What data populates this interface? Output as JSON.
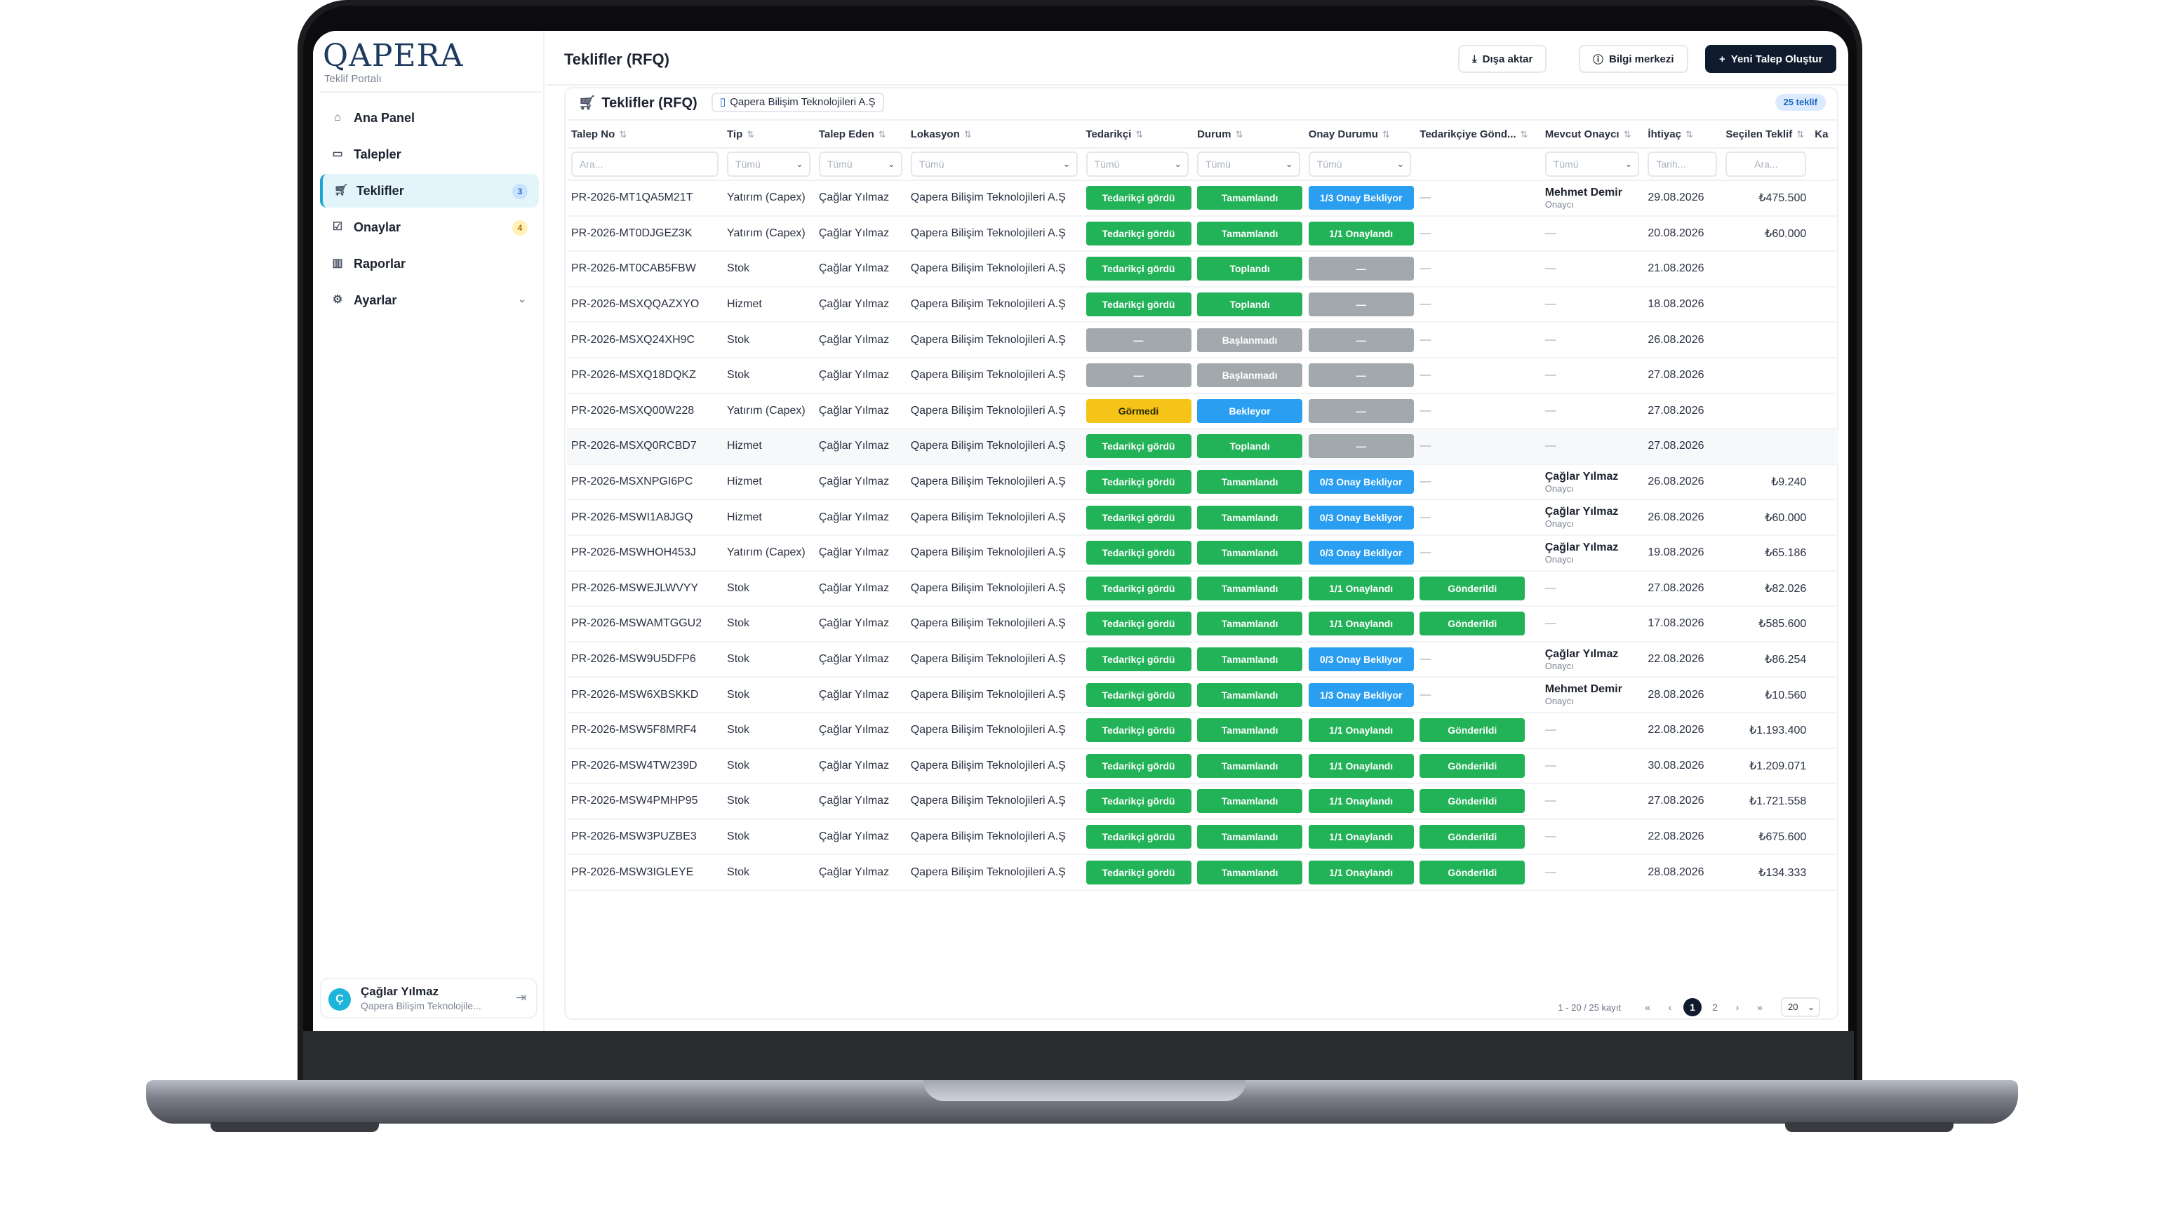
{
  "app": {
    "logo": "QAPERA",
    "subtitle": "Teklif Portalı"
  },
  "sidebar": {
    "items": [
      {
        "label": "Ana Panel",
        "icon": "home-icon"
      },
      {
        "label": "Talepler",
        "icon": "document-icon"
      },
      {
        "label": "Teklifler",
        "icon": "cart-icon",
        "badge": "3",
        "active": true
      },
      {
        "label": "Onaylar",
        "icon": "check-square-icon",
        "badge": "4"
      },
      {
        "label": "Raporlar",
        "icon": "bar-chart-icon"
      },
      {
        "label": "Ayarlar",
        "icon": "gear-icon"
      }
    ],
    "user": {
      "initial": "Ç",
      "name": "Çağlar Yılmaz",
      "company": "Qapera Bilişim Teknolojile..."
    }
  },
  "header": {
    "title": "Teklifler (RFQ)",
    "export_label": "Dışa aktar",
    "info_label": "Bilgi merkezi",
    "new_label": "Yeni Talep Oluştur"
  },
  "card": {
    "title": "Teklifler (RFQ)",
    "company": "Qapera Bilişim Teknolojileri A.Ş",
    "count": "25 teklif"
  },
  "table": {
    "columns": [
      "Talep No",
      "Tip",
      "Talep Eden",
      "Lokasyon",
      "Tedarikçi",
      "Durum",
      "Onay Durumu",
      "Tedarikçiye Gönd...",
      "Mevcut Onaycı",
      "İhtiyaç",
      "Seçilen Teklif",
      "Ka"
    ],
    "filters": {
      "talep_no": "Ara...",
      "tip": "Tümü",
      "talep_eden": "Tümü",
      "lokasyon": "Tümü",
      "tedarikci": "Tümü",
      "durum": "Tümü",
      "onay": "Tümü",
      "onayci": "Tümü",
      "ihtiyac": "Tarih...",
      "secilen": "Ara..."
    },
    "rows": [
      {
        "no": "PR-2026-MT1QA5M21T",
        "tip": "Yatırım (Capex)",
        "eden": "Çağlar Yılmaz",
        "lok": "Qapera Bilişim Teknolojileri A.Ş",
        "ted": "Tedarikçi gördü",
        "ted_c": "green",
        "dur": "Tamamlandı",
        "dur_c": "green",
        "onay": "1/3 Onay Bekliyor",
        "onay_c": "blue",
        "gond": "—",
        "gond_c": "",
        "onayci": "Mehmet Demir",
        "rol": "Onaycı",
        "tarih": "29.08.2026",
        "teklif": "₺475.500"
      },
      {
        "no": "PR-2026-MT0DJGEZ3K",
        "tip": "Yatırım (Capex)",
        "eden": "Çağlar Yılmaz",
        "lok": "Qapera Bilişim Teknolojileri A.Ş",
        "ted": "Tedarikçi gördü",
        "ted_c": "green",
        "dur": "Tamamlandı",
        "dur_c": "green",
        "onay": "1/1 Onaylandı",
        "onay_c": "green",
        "gond": "—",
        "gond_c": "",
        "onayci": "—",
        "rol": "",
        "tarih": "20.08.2026",
        "teklif": "₺60.000"
      },
      {
        "no": "PR-2026-MT0CAB5FBW",
        "tip": "Stok",
        "eden": "Çağlar Yılmaz",
        "lok": "Qapera Bilişim Teknolojileri A.Ş",
        "ted": "Tedarikçi gördü",
        "ted_c": "green",
        "dur": "Toplandı",
        "dur_c": "green",
        "onay": "—",
        "onay_c": "gray",
        "gond": "—",
        "gond_c": "",
        "onayci": "—",
        "rol": "",
        "tarih": "21.08.2026",
        "teklif": ""
      },
      {
        "no": "PR-2026-MSXQQAZXYO",
        "tip": "Hizmet",
        "eden": "Çağlar Yılmaz",
        "lok": "Qapera Bilişim Teknolojileri A.Ş",
        "ted": "Tedarikçi gördü",
        "ted_c": "green",
        "dur": "Toplandı",
        "dur_c": "green",
        "onay": "—",
        "onay_c": "gray",
        "gond": "—",
        "gond_c": "",
        "onayci": "—",
        "rol": "",
        "tarih": "18.08.2026",
        "teklif": ""
      },
      {
        "no": "PR-2026-MSXQ24XH9C",
        "tip": "Stok",
        "eden": "Çağlar Yılmaz",
        "lok": "Qapera Bilişim Teknolojileri A.Ş",
        "ted": "—",
        "ted_c": "gray",
        "dur": "Başlanmadı",
        "dur_c": "gray",
        "onay": "—",
        "onay_c": "gray",
        "gond": "—",
        "gond_c": "",
        "onayci": "—",
        "rol": "",
        "tarih": "26.08.2026",
        "teklif": ""
      },
      {
        "no": "PR-2026-MSXQ18DQKZ",
        "tip": "Stok",
        "eden": "Çağlar Yılmaz",
        "lok": "Qapera Bilişim Teknolojileri A.Ş",
        "ted": "—",
        "ted_c": "gray",
        "dur": "Başlanmadı",
        "dur_c": "gray",
        "onay": "—",
        "onay_c": "gray",
        "gond": "—",
        "gond_c": "",
        "onayci": "—",
        "rol": "",
        "tarih": "27.08.2026",
        "teklif": ""
      },
      {
        "no": "PR-2026-MSXQ00W228",
        "tip": "Yatırım (Capex)",
        "eden": "Çağlar Yılmaz",
        "lok": "Qapera Bilişim Teknolojileri A.Ş",
        "ted": "Görmedi",
        "ted_c": "yellow",
        "dur": "Bekleyor",
        "dur_c": "blue",
        "onay": "—",
        "onay_c": "gray",
        "gond": "—",
        "gond_c": "",
        "onayci": "—",
        "rol": "",
        "tarih": "27.08.2026",
        "teklif": ""
      },
      {
        "no": "PR-2026-MSXQ0RCBD7",
        "tip": "Hizmet",
        "eden": "Çağlar Yılmaz",
        "lok": "Qapera Bilişim Teknolojileri A.Ş",
        "ted": "Tedarikçi gördü",
        "ted_c": "green",
        "dur": "Toplandı",
        "dur_c": "green",
        "onay": "—",
        "onay_c": "gray",
        "gond": "—",
        "gond_c": "",
        "onayci": "—",
        "rol": "",
        "tarih": "27.08.2026",
        "teklif": ""
      },
      {
        "no": "PR-2026-MSXNPGI6PC",
        "tip": "Hizmet",
        "eden": "Çağlar Yılmaz",
        "lok": "Qapera Bilişim Teknolojileri A.Ş",
        "ted": "Tedarikçi gördü",
        "ted_c": "green",
        "dur": "Tamamlandı",
        "dur_c": "green",
        "onay": "0/3 Onay Bekliyor",
        "onay_c": "blue",
        "gond": "—",
        "gond_c": "",
        "onayci": "Çağlar Yılmaz",
        "rol": "Onaycı",
        "tarih": "26.08.2026",
        "teklif": "₺9.240"
      },
      {
        "no": "PR-2026-MSWI1A8JGQ",
        "tip": "Hizmet",
        "eden": "Çağlar Yılmaz",
        "lok": "Qapera Bilişim Teknolojileri A.Ş",
        "ted": "Tedarikçi gördü",
        "ted_c": "green",
        "dur": "Tamamlandı",
        "dur_c": "green",
        "onay": "0/3 Onay Bekliyor",
        "onay_c": "blue",
        "gond": "—",
        "gond_c": "",
        "onayci": "Çağlar Yılmaz",
        "rol": "Onaycı",
        "tarih": "26.08.2026",
        "teklif": "₺60.000"
      },
      {
        "no": "PR-2026-MSWHOH453J",
        "tip": "Yatırım (Capex)",
        "eden": "Çağlar Yılmaz",
        "lok": "Qapera Bilişim Teknolojileri A.Ş",
        "ted": "Tedarikçi gördü",
        "ted_c": "green",
        "dur": "Tamamlandı",
        "dur_c": "green",
        "onay": "0/3 Onay Bekliyor",
        "onay_c": "blue",
        "gond": "—",
        "gond_c": "",
        "onayci": "Çağlar Yılmaz",
        "rol": "Onaycı",
        "tarih": "19.08.2026",
        "teklif": "₺65.186"
      },
      {
        "no": "PR-2026-MSWEJLWVYY",
        "tip": "Stok",
        "eden": "Çağlar Yılmaz",
        "lok": "Qapera Bilişim Teknolojileri A.Ş",
        "ted": "Tedarikçi gördü",
        "ted_c": "green",
        "dur": "Tamamlandı",
        "dur_c": "green",
        "onay": "1/1 Onaylandı",
        "onay_c": "green",
        "gond": "Gönderildi",
        "gond_c": "green",
        "onayci": "—",
        "rol": "",
        "tarih": "27.08.2026",
        "teklif": "₺82.026"
      },
      {
        "no": "PR-2026-MSWAMTGGU2",
        "tip": "Stok",
        "eden": "Çağlar Yılmaz",
        "lok": "Qapera Bilişim Teknolojileri A.Ş",
        "ted": "Tedarikçi gördü",
        "ted_c": "green",
        "dur": "Tamamlandı",
        "dur_c": "green",
        "onay": "1/1 Onaylandı",
        "onay_c": "green",
        "gond": "Gönderildi",
        "gond_c": "green",
        "onayci": "—",
        "rol": "",
        "tarih": "17.08.2026",
        "teklif": "₺585.600"
      },
      {
        "no": "PR-2026-MSW9U5DFP6",
        "tip": "Stok",
        "eden": "Çağlar Yılmaz",
        "lok": "Qapera Bilişim Teknolojileri A.Ş",
        "ted": "Tedarikçi gördü",
        "ted_c": "green",
        "dur": "Tamamlandı",
        "dur_c": "green",
        "onay": "0/3 Onay Bekliyor",
        "onay_c": "blue",
        "gond": "—",
        "gond_c": "",
        "onayci": "Çağlar Yılmaz",
        "rol": "Onaycı",
        "tarih": "22.08.2026",
        "teklif": "₺86.254"
      },
      {
        "no": "PR-2026-MSW6XBSKKD",
        "tip": "Stok",
        "eden": "Çağlar Yılmaz",
        "lok": "Qapera Bilişim Teknolojileri A.Ş",
        "ted": "Tedarikçi gördü",
        "ted_c": "green",
        "dur": "Tamamlandı",
        "dur_c": "green",
        "onay": "1/3 Onay Bekliyor",
        "onay_c": "blue",
        "gond": "—",
        "gond_c": "",
        "onayci": "Mehmet Demir",
        "rol": "Onaycı",
        "tarih": "28.08.2026",
        "teklif": "₺10.560"
      },
      {
        "no": "PR-2026-MSW5F8MRF4",
        "tip": "Stok",
        "eden": "Çağlar Yılmaz",
        "lok": "Qapera Bilişim Teknolojileri A.Ş",
        "ted": "Tedarikçi gördü",
        "ted_c": "green",
        "dur": "Tamamlandı",
        "dur_c": "green",
        "onay": "1/1 Onaylandı",
        "onay_c": "green",
        "gond": "Gönderildi",
        "gond_c": "green",
        "onayci": "—",
        "rol": "",
        "tarih": "22.08.2026",
        "teklif": "₺1.193.400"
      },
      {
        "no": "PR-2026-MSW4TW239D",
        "tip": "Stok",
        "eden": "Çağlar Yılmaz",
        "lok": "Qapera Bilişim Teknolojileri A.Ş",
        "ted": "Tedarikçi gördü",
        "ted_c": "green",
        "dur": "Tamamlandı",
        "dur_c": "green",
        "onay": "1/1 Onaylandı",
        "onay_c": "green",
        "gond": "Gönderildi",
        "gond_c": "green",
        "onayci": "—",
        "rol": "",
        "tarih": "30.08.2026",
        "teklif": "₺1.209.071"
      },
      {
        "no": "PR-2026-MSW4PMHP95",
        "tip": "Stok",
        "eden": "Çağlar Yılmaz",
        "lok": "Qapera Bilişim Teknolojileri A.Ş",
        "ted": "Tedarikçi gördü",
        "ted_c": "green",
        "dur": "Tamamlandı",
        "dur_c": "green",
        "onay": "1/1 Onaylandı",
        "onay_c": "green",
        "gond": "Gönderildi",
        "gond_c": "green",
        "onayci": "—",
        "rol": "",
        "tarih": "27.08.2026",
        "teklif": "₺1.721.558"
      },
      {
        "no": "PR-2026-MSW3PUZBE3",
        "tip": "Stok",
        "eden": "Çağlar Yılmaz",
        "lok": "Qapera Bilişim Teknolojileri A.Ş",
        "ted": "Tedarikçi gördü",
        "ted_c": "green",
        "dur": "Tamamlandı",
        "dur_c": "green",
        "onay": "1/1 Onaylandı",
        "onay_c": "green",
        "gond": "Gönderildi",
        "gond_c": "green",
        "onayci": "—",
        "rol": "",
        "tarih": "22.08.2026",
        "teklif": "₺675.600"
      },
      {
        "no": "PR-2026-MSW3IGLEYE",
        "tip": "Stok",
        "eden": "Çağlar Yılmaz",
        "lok": "Qapera Bilişim Teknolojileri A.Ş",
        "ted": "Tedarikçi gördü",
        "ted_c": "green",
        "dur": "Tamamlandı",
        "dur_c": "green",
        "onay": "1/1 Onaylandı",
        "onay_c": "green",
        "gond": "Gönderildi",
        "gond_c": "green",
        "onayci": "—",
        "rol": "",
        "tarih": "28.08.2026",
        "teklif": "₺134.333"
      }
    ]
  },
  "pagination": {
    "info": "1 - 20 / 25 kayıt",
    "first": "«",
    "prev": "‹",
    "pages": [
      "1",
      "2"
    ],
    "next": "›",
    "last": "»",
    "page_size": "20"
  },
  "colors": {
    "accent": "#18a5d1",
    "green": "#22b257",
    "blue": "#2a9ef0",
    "yellow": "#f5c419",
    "gray": "#a2a9ad",
    "primary_button": "#0f1b2d"
  }
}
